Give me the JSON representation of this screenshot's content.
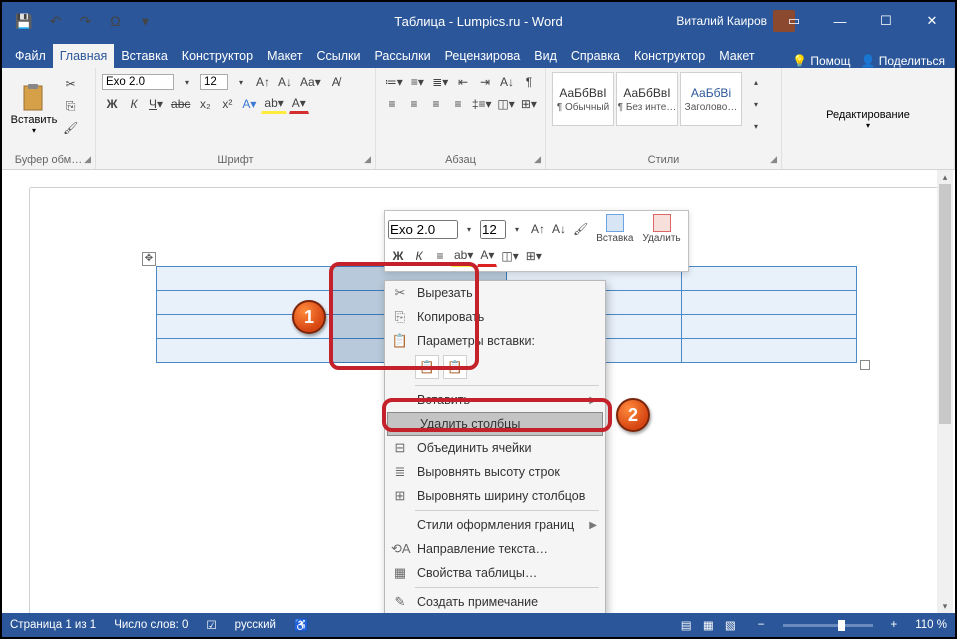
{
  "window": {
    "title": "Таблица - Lumpics.ru  -  Word",
    "user": "Виталий Каиров"
  },
  "qat": {
    "save": "💾",
    "undo": "↶",
    "redo": "↷",
    "omega": "Ω"
  },
  "tabs": {
    "file": "Файл",
    "home": "Главная",
    "insert": "Вставка",
    "design": "Конструктор",
    "layout": "Макет",
    "references": "Ссылки",
    "mailings": "Рассылки",
    "review": "Рецензирова",
    "view": "Вид",
    "help": "Справка",
    "table_design": "Конструктор",
    "table_layout": "Макет",
    "tell_me": "Помощ",
    "share": "Поделиться"
  },
  "ribbon": {
    "clipboard": {
      "paste": "Вставить",
      "label": "Буфер обм…"
    },
    "font": {
      "name": "Exo 2.0",
      "size": "12",
      "label": "Шрифт"
    },
    "paragraph": {
      "label": "Абзац"
    },
    "styles": {
      "label": "Стили",
      "s1": "АаБбВвІ",
      "s1_name": "¶ Обычный",
      "s2": "АаБбВвІ",
      "s2_name": "¶ Без инте…",
      "s3": "АаБбВі",
      "s3_name": "Заголово…"
    },
    "editing": {
      "label": "Редактирование"
    }
  },
  "mini": {
    "font_name": "Exo 2.0",
    "font_size": "12",
    "insert": "Вставка",
    "delete": "Удалить",
    "bold": "Ж",
    "italic": "К"
  },
  "context_menu": {
    "cut": "Вырезать",
    "copy": "Копировать",
    "paste_options": "Параметры вставки:",
    "insert": "Вставить",
    "delete_columns": "Удалить столбцы",
    "merge_cells": "Объединить ячейки",
    "distribute_rows": "Выровнять высоту строк",
    "distribute_cols": "Выровнять ширину столбцов",
    "border_styles": "Стили оформления границ",
    "text_direction": "Направление текста…",
    "table_properties": "Свойства таблицы…",
    "new_comment": "Создать примечание"
  },
  "status": {
    "page": "Страница 1 из 1",
    "words": "Число слов: 0",
    "lang": "русский",
    "zoom": "110 %"
  },
  "annotations": {
    "n1": "1",
    "n2": "2"
  }
}
